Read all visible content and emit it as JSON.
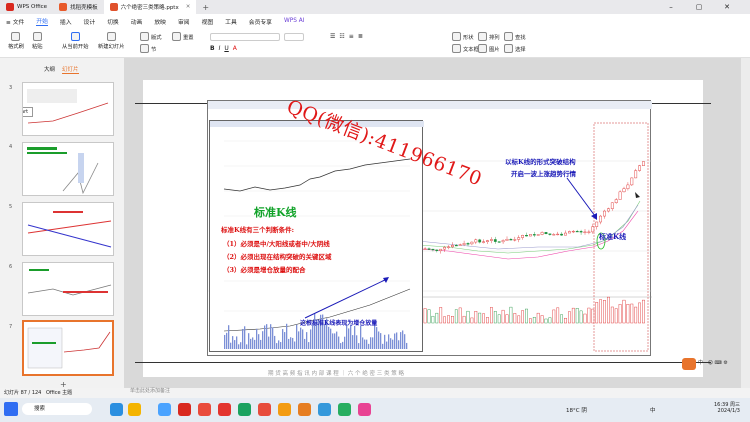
{
  "titlebar": {
    "tabs": [
      {
        "label": "WPS Office",
        "color": "#d9291f"
      },
      {
        "label": "找稻壳模板",
        "color": "#e85a2b"
      },
      {
        "label": "六个绝密三类策略.pptx",
        "color": "#e0522c"
      }
    ],
    "add_tab": "+"
  },
  "menu": {
    "file": "≡ 文件",
    "items": [
      "开始",
      "插入",
      "设计",
      "切换",
      "动画",
      "放映",
      "审阅",
      "视图",
      "工具",
      "会员专享"
    ],
    "wps_ai": "WPS AI"
  },
  "ribbon": {
    "left": [
      {
        "label": "格式刷"
      },
      {
        "label": "粘贴"
      },
      {
        "label": "从当前开始"
      },
      {
        "label": "新建幻灯片"
      },
      {
        "label": "版式"
      },
      {
        "label": "节"
      }
    ],
    "reset": "重置",
    "right": [
      {
        "label": "形状"
      },
      {
        "label": "文本框"
      },
      {
        "label": "排列"
      },
      {
        "label": "图片"
      },
      {
        "label": "查找"
      },
      {
        "label": "选择"
      }
    ]
  },
  "thumbs": {
    "tabs": [
      "大纲",
      "幻灯片"
    ],
    "numbers": [
      "3",
      "4",
      "5",
      "6",
      "7"
    ],
    "start_label": "Start"
  },
  "slide": {
    "watermark": "QQ(微信):411966170",
    "chart_title_std": "标准K线",
    "conditions_title": "标准K线有三个判断条件:",
    "conditions": [
      "（1）必须是中/大阳线或者中/大阴线",
      "（2）必须出现在结构突破的关键区域",
      "（3）必须是增仓放量的配合"
    ],
    "volume_note": "这根标准K线表现为增仓放量",
    "breakout_note_1": "以标K线的形式突破结构",
    "breakout_note_2": "开启一波上涨趋势行情",
    "kline_label": "标准K线",
    "footer_tagline": "期 货 高 频 指 讯 内 部 课 程 ｜ 六 个 绝 密 三 类 策 略"
  },
  "status": {
    "slide_info": "幻灯片 87 / 124",
    "theme": "Office 主题",
    "notes": "单击此处添加备注"
  },
  "taskbar": {
    "search": "搜索",
    "weather": "18°C",
    "weather_text": "阴",
    "time": "16:39 周三",
    "date": "2024/1/3",
    "ime": "中"
  },
  "colors": {
    "accent": "#2f6df2",
    "watermark_red": "#e01818",
    "green_title": "#12a32a",
    "note_blue": "#1b1bb8",
    "selection_orange": "#e8742c"
  }
}
